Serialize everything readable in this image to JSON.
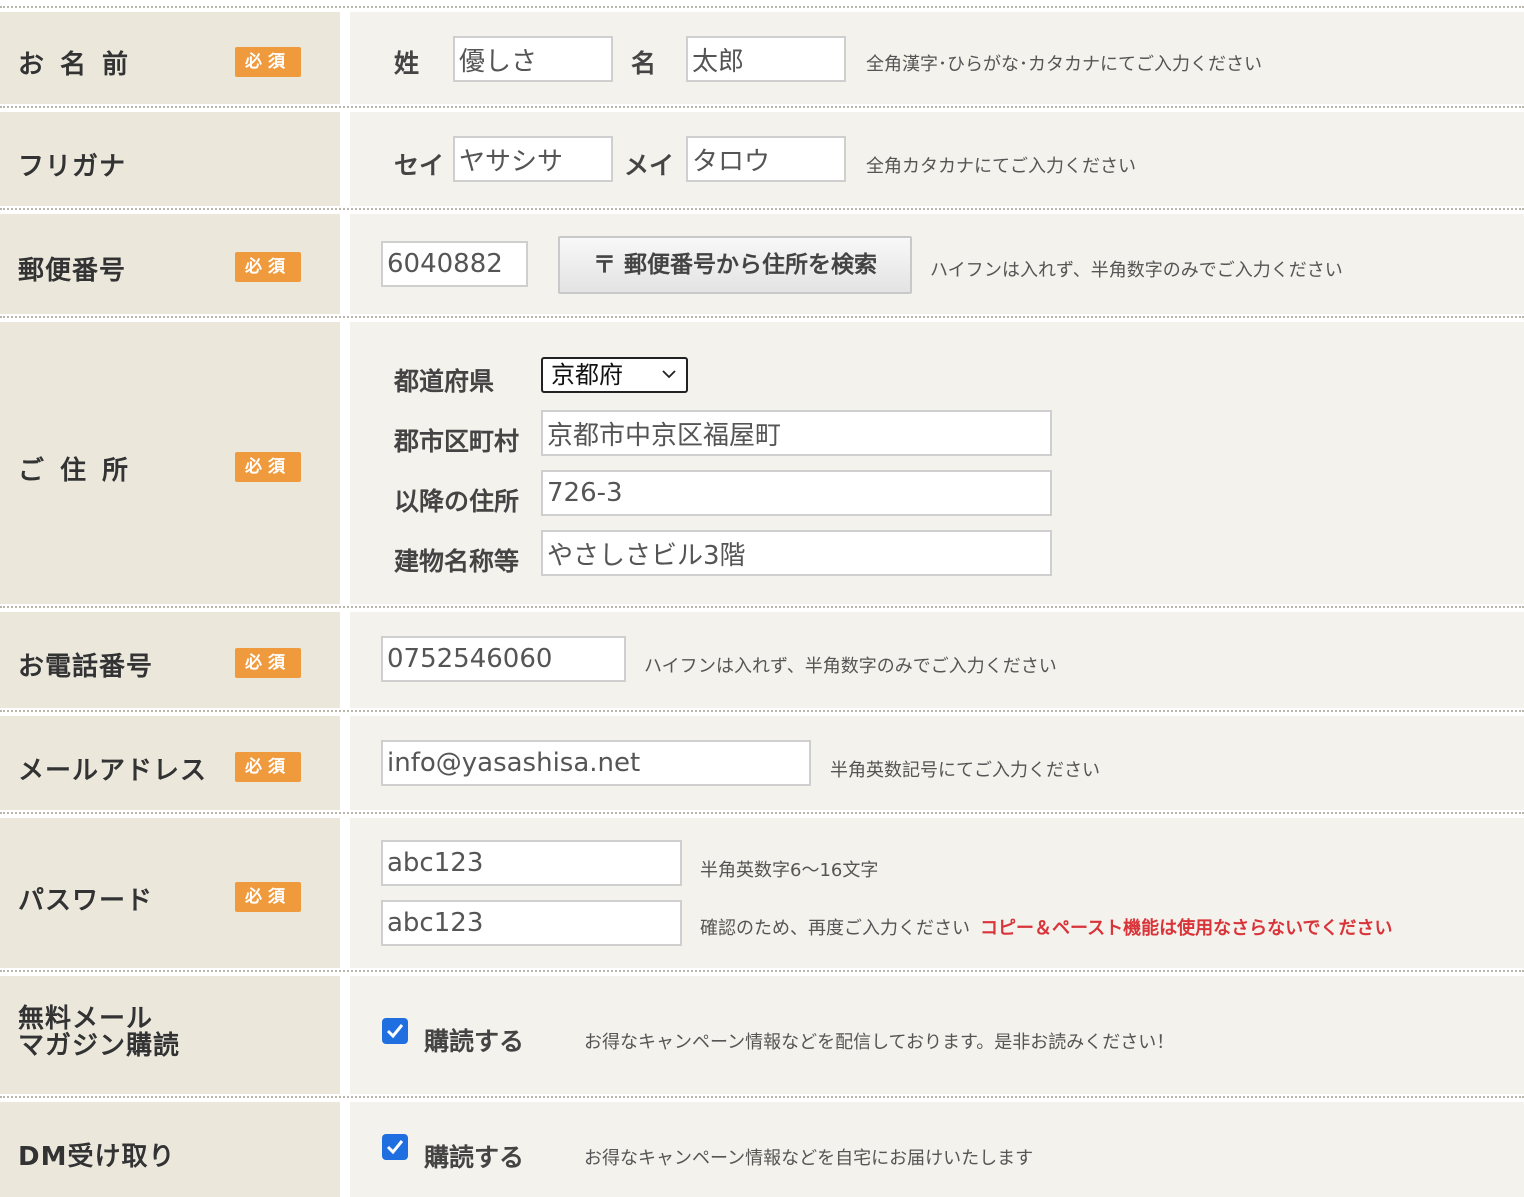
{
  "required_badge": "必須",
  "name": {
    "label": "お名前",
    "sei_label": "姓",
    "sei_value": "優しさ",
    "mei_label": "名",
    "mei_value": "太郎",
    "hint": "全角漢字･ひらがな･カタカナにてご入力ください"
  },
  "furigana": {
    "label": "フリガナ",
    "sei_label": "セイ",
    "sei_value": "ヤサシサ",
    "mei_label": "メイ",
    "mei_value": "タロウ",
    "hint": "全角カタカナにてご入力ください"
  },
  "zip": {
    "label": "郵便番号",
    "value": "6040882",
    "button_label": "〒 郵便番号から住所を検索",
    "hint": "ハイフンは入れず、半角数字のみでご入力ください"
  },
  "address": {
    "label": "ご住所",
    "pref_label": "都道府県",
    "pref_value": "京都府",
    "city_label": "郡市区町村",
    "city_value": "京都市中京区福屋町",
    "street_label": "以降の住所",
    "street_value": "726-3",
    "building_label": "建物名称等",
    "building_value": "やさしさビル3階"
  },
  "phone": {
    "label": "お電話番号",
    "value": "0752546060",
    "hint": "ハイフンは入れず、半角数字のみでご入力ください"
  },
  "email": {
    "label": "メールアドレス",
    "value": "info@yasashisa.net",
    "hint": "半角英数記号にてご入力ください"
  },
  "password": {
    "label": "パスワード",
    "value": "abc123",
    "confirm_value": "abc123",
    "hint": "半角英数字6～16文字",
    "confirm_hint": "確認のため、再度ご入力ください",
    "warning": "コピー＆ペースト機能は使用なさらないでください"
  },
  "mail_magazine": {
    "label_line1": "無料メール",
    "label_line2": "マガジン購読",
    "checked": true,
    "checkbox_label": "購読する",
    "hint": "お得なキャンペーン情報などを配信しております。是非お読みください！"
  },
  "dm": {
    "label": "DM受け取り",
    "checked": true,
    "checkbox_label": "購読する",
    "hint": "お得なキャンペーン情報などを自宅にお届けいたします"
  },
  "colors": {
    "label_bg": "#ebe7da",
    "content_bg": "#f4f2ec",
    "badge": "#f09a3e",
    "checkbox": "#1f6fe0",
    "warning": "#d9343a"
  }
}
